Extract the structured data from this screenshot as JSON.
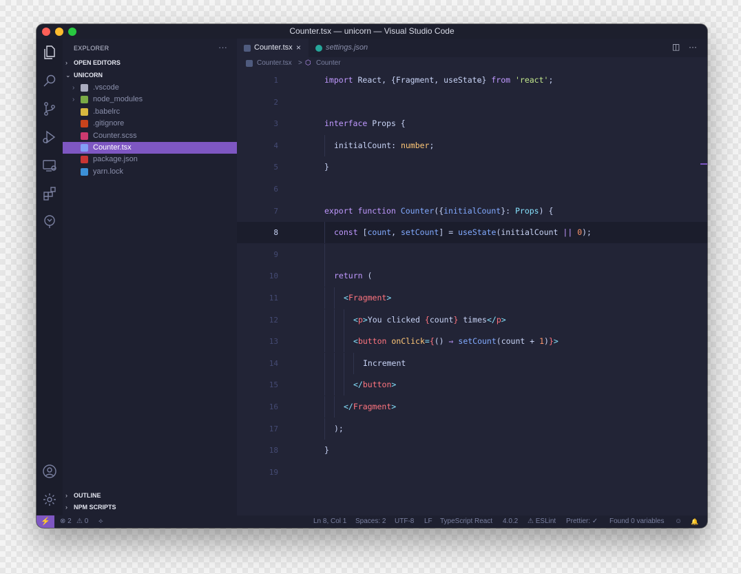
{
  "window": {
    "title": "Counter.tsx — unicorn — Visual Studio Code"
  },
  "activity_icons": [
    "files-icon",
    "search-icon",
    "source-control-icon",
    "run-debug-icon",
    "remote-explorer-icon",
    "extensions-icon",
    "gitlens-icon",
    "account-icon",
    "settings-gear-icon"
  ],
  "sidebar": {
    "title": "EXPLORER",
    "more": "···",
    "open_editors": "OPEN EDITORS",
    "folder": "UNICORN",
    "files": [
      {
        "label": ".vscode",
        "icon": "folder-icon",
        "color": "#c3c6d8",
        "chevron": true
      },
      {
        "label": "node_modules",
        "icon": "node-icon",
        "color": "#8bc34a",
        "chevron": true
      },
      {
        "label": ".babelrc",
        "icon": "babel-icon",
        "color": "#f9d342",
        "chevron": false
      },
      {
        "label": ".gitignore",
        "icon": "git-icon",
        "color": "#e64a19",
        "chevron": false
      },
      {
        "label": "Counter.scss",
        "icon": "sass-icon",
        "color": "#ec407a",
        "chevron": false
      },
      {
        "label": "Counter.tsx",
        "icon": "tsx-icon",
        "color": "#82aaff",
        "chevron": false
      },
      {
        "label": "package.json",
        "icon": "npm-icon",
        "color": "#e53935",
        "chevron": false
      },
      {
        "label": "yarn.lock",
        "icon": "yarn-icon",
        "color": "#42a5f5",
        "chevron": false
      }
    ],
    "active_file": "Counter.tsx",
    "outline": "OUTLINE",
    "npm_scripts": "NPM SCRIPTS"
  },
  "tabs": [
    {
      "label": "Counter.tsx",
      "close": "×"
    },
    {
      "label": "settings.json"
    }
  ],
  "tab_actions": {
    "split": "◫",
    "more": "···"
  },
  "breadcrumb": {
    "file": "Counter.tsx",
    "separator": ">",
    "symbol": "Counter"
  },
  "editor": {
    "current_line": 8,
    "hint": "…",
    "lines": [
      {
        "n": "1",
        "indent": 0,
        "tokens": [
          {
            "t": "import ",
            "c": "kw"
          },
          {
            "t": "React, {Fragment, useState} ",
            "c": "var"
          },
          {
            "t": "from ",
            "c": "kw"
          },
          {
            "t": "'react'",
            "c": "str"
          },
          {
            "t": ";",
            "c": "var"
          }
        ]
      },
      {
        "n": "2",
        "indent": 0,
        "tokens": []
      },
      {
        "n": "3",
        "indent": 0,
        "tokens": [
          {
            "t": "interface ",
            "c": "kw"
          },
          {
            "t": "Props {",
            "c": "var"
          }
        ]
      },
      {
        "n": "4",
        "indent": 1,
        "tokens": [
          {
            "t": "initialCount: ",
            "c": "var"
          },
          {
            "t": "number",
            "c": "type"
          },
          {
            "t": ";",
            "c": "var"
          }
        ]
      },
      {
        "n": "5",
        "indent": 0,
        "tokens": [
          {
            "t": "}",
            "c": "var"
          }
        ]
      },
      {
        "n": "6",
        "indent": 0,
        "tokens": []
      },
      {
        "n": "7",
        "indent": 0,
        "tokens": [
          {
            "t": "export ",
            "c": "kw"
          },
          {
            "t": "function ",
            "c": "kw"
          },
          {
            "t": "Counter",
            "c": "fn"
          },
          {
            "t": "({",
            "c": "var"
          },
          {
            "t": "initialCount",
            "c": "fn"
          },
          {
            "t": "}: ",
            "c": "var"
          },
          {
            "t": "Props",
            "c": "pv"
          },
          {
            "t": ") {",
            "c": "var"
          }
        ]
      },
      {
        "n": "8",
        "indent": 1,
        "tokens": [
          {
            "t": "const ",
            "c": "kw"
          },
          {
            "t": "[",
            "c": "var"
          },
          {
            "t": "count",
            "c": "fn"
          },
          {
            "t": ", ",
            "c": "var"
          },
          {
            "t": "setCount",
            "c": "fn"
          },
          {
            "t": "] = ",
            "c": "var"
          },
          {
            "t": "useState",
            "c": "fn"
          },
          {
            "t": "(initialCount ",
            "c": "var"
          },
          {
            "t": "||",
            "c": "kw"
          },
          {
            "t": " ",
            "c": "var"
          },
          {
            "t": "0",
            "c": "num"
          },
          {
            "t": ");",
            "c": "var"
          }
        ]
      },
      {
        "n": "9",
        "indent": 1,
        "tokens": []
      },
      {
        "n": "10",
        "indent": 1,
        "tokens": [
          {
            "t": "return ",
            "c": "kw"
          },
          {
            "t": "(",
            "c": "var"
          }
        ]
      },
      {
        "n": "11",
        "indent": 2,
        "tokens": [
          {
            "t": "<",
            "c": "punc"
          },
          {
            "t": "Fragment",
            "c": "tag"
          },
          {
            "t": ">",
            "c": "punc"
          }
        ]
      },
      {
        "n": "12",
        "indent": 3,
        "tokens": [
          {
            "t": "<",
            "c": "punc"
          },
          {
            "t": "p",
            "c": "tag"
          },
          {
            "t": ">",
            "c": "punc"
          },
          {
            "t": "You clicked ",
            "c": "var"
          },
          {
            "t": "{",
            "c": "tag"
          },
          {
            "t": "count",
            "c": "var"
          },
          {
            "t": "}",
            "c": "tag"
          },
          {
            "t": " times",
            "c": "var"
          },
          {
            "t": "</",
            "c": "punc"
          },
          {
            "t": "p",
            "c": "tag"
          },
          {
            "t": ">",
            "c": "punc"
          }
        ]
      },
      {
        "n": "13",
        "indent": 3,
        "tokens": [
          {
            "t": "<",
            "c": "punc"
          },
          {
            "t": "button ",
            "c": "tag"
          },
          {
            "t": "onClick",
            "c": "attr"
          },
          {
            "t": "=",
            "c": "punc"
          },
          {
            "t": "{",
            "c": "tag"
          },
          {
            "t": "() ",
            "c": "var"
          },
          {
            "t": "⇒ ",
            "c": "kw"
          },
          {
            "t": "setCount",
            "c": "fn"
          },
          {
            "t": "(count + ",
            "c": "var"
          },
          {
            "t": "1",
            "c": "num"
          },
          {
            "t": ")",
            "c": "var"
          },
          {
            "t": "}",
            "c": "tag"
          },
          {
            "t": ">",
            "c": "punc"
          }
        ]
      },
      {
        "n": "14",
        "indent": 4,
        "tokens": [
          {
            "t": "Increment",
            "c": "var"
          }
        ]
      },
      {
        "n": "15",
        "indent": 3,
        "tokens": [
          {
            "t": "</",
            "c": "punc"
          },
          {
            "t": "button",
            "c": "tag"
          },
          {
            "t": ">",
            "c": "punc"
          }
        ]
      },
      {
        "n": "16",
        "indent": 2,
        "tokens": [
          {
            "t": "</",
            "c": "punc"
          },
          {
            "t": "Fragment",
            "c": "tag"
          },
          {
            "t": ">",
            "c": "punc"
          }
        ]
      },
      {
        "n": "17",
        "indent": 1,
        "tokens": [
          {
            "t": ");",
            "c": "var"
          }
        ]
      },
      {
        "n": "18",
        "indent": 0,
        "tokens": [
          {
            "t": "}",
            "c": "var"
          }
        ]
      },
      {
        "n": "19",
        "indent": 0,
        "tokens": []
      }
    ]
  },
  "statusbar": {
    "remote": "⚡",
    "errors": "⊗ 2",
    "warnings": "⚠ 0",
    "branch_icon": "⟡",
    "position": "Ln 8, Col 1",
    "spaces": "Spaces: 2",
    "encoding": "UTF-8",
    "eol": "LF",
    "language": "TypeScript React",
    "ts_version": "4.0.2",
    "eslint": "⚠ ESLint",
    "prettier": "Prettier: ✓",
    "variables": "Found 0 variables",
    "feedback": "☺",
    "bell": "🔔"
  },
  "colors": {
    "accent": "#7e57c2",
    "editor_bg": "#222436",
    "sidebar_bg": "#1e2030"
  }
}
